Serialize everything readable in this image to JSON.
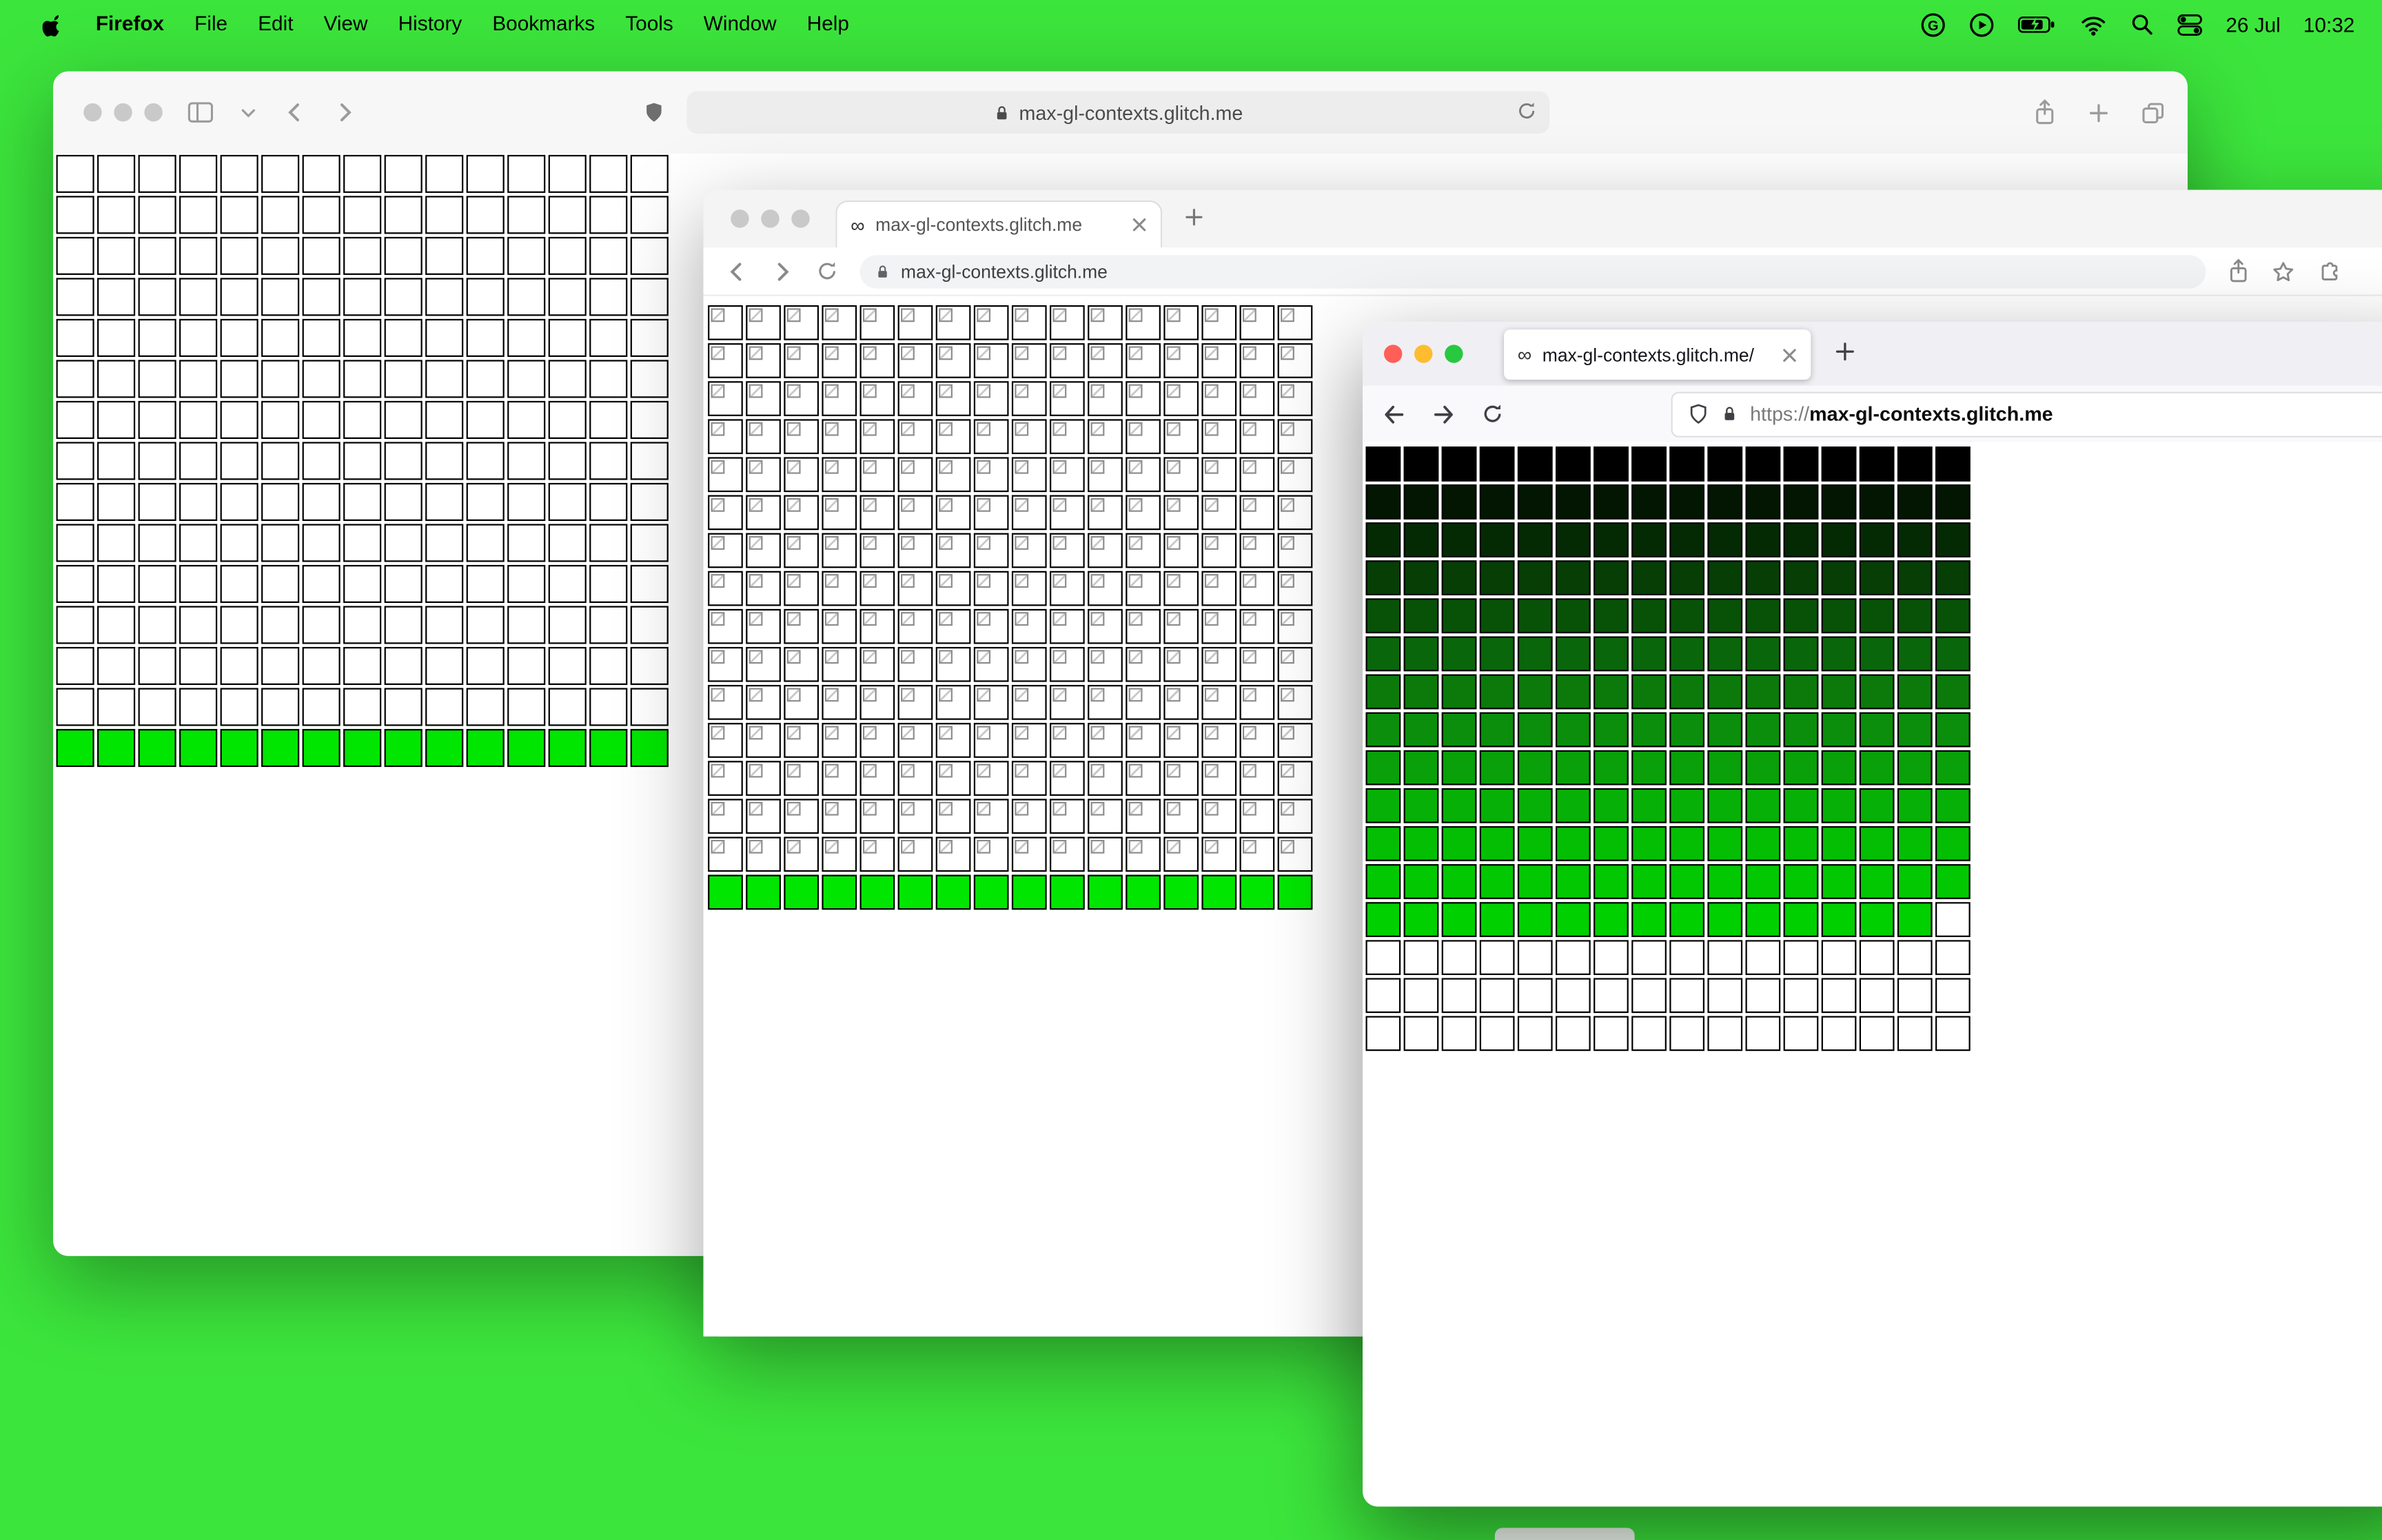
{
  "menu_bar": {
    "app_name": "Firefox",
    "menus": [
      "File",
      "Edit",
      "View",
      "History",
      "Bookmarks",
      "Tools",
      "Window",
      "Help"
    ],
    "date": "26 Jul",
    "time": "10:32"
  },
  "safari_window": {
    "url": "max-gl-contexts.glitch.me"
  },
  "chrome_window": {
    "tab_favicon": "∞",
    "tab_title": "max-gl-contexts.glitch.me",
    "url": "max-gl-contexts.glitch.me"
  },
  "firefox_window": {
    "tab_favicon": "∞",
    "tab_title": "max-gl-contexts.glitch.me/",
    "url_scheme": "https://",
    "url_host": "max-gl-contexts.glitch.me"
  },
  "colors": {
    "desktop_green": "#3ce53c",
    "grid_green": "#00e600",
    "gradient_end_green": "#00d000"
  },
  "grids": {
    "safari": {
      "cols": 15,
      "cell": 25,
      "gap": 2,
      "rows": [
        {
          "color": "#ffffff",
          "repeat": 14
        },
        {
          "color": "#00e600"
        }
      ]
    },
    "chrome": {
      "cols": 16,
      "cell": 23,
      "gap": 2,
      "rows": [
        {
          "color": "#ffffff",
          "repeat": 15,
          "broken": true
        },
        {
          "color": "#00e600"
        }
      ]
    },
    "firefox": {
      "cols": 16,
      "cell": 23,
      "gap": 2,
      "rows": [
        {
          "color": "#000000"
        },
        {
          "color": "#021602"
        },
        {
          "color": "#042a04"
        },
        {
          "color": "#063e06"
        },
        {
          "color": "#085208"
        },
        {
          "color": "#0a660a"
        },
        {
          "color": "#0b7a0b"
        },
        {
          "color": "#0b8e0b"
        },
        {
          "color": "#09a009"
        },
        {
          "color": "#07b007"
        },
        {
          "color": "#04be04"
        },
        {
          "color": "#02c802"
        },
        {
          "color": "#00d000",
          "filled": 15
        },
        {
          "color": "#ffffff",
          "repeat": 3
        }
      ]
    }
  }
}
